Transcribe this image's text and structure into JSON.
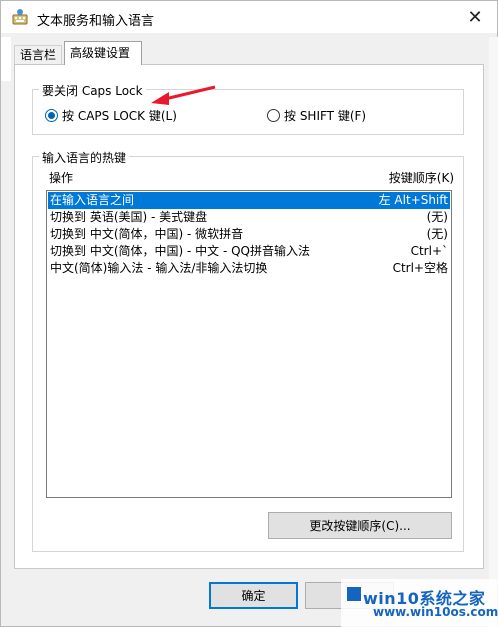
{
  "window": {
    "title": "文本服务和输入语言",
    "close_glyph": "✕"
  },
  "tabs": [
    {
      "label": "语言栏"
    },
    {
      "label": "高级键设置"
    }
  ],
  "caps_lock_group": {
    "label": "要关闭 Caps Lock",
    "option_caps": "按 CAPS LOCK 键(L)",
    "option_shift": "按 SHIFT 键(F)",
    "selected": "caps"
  },
  "hotkeys_group": {
    "label": "输入语言的热键",
    "col_operation": "操作",
    "col_sequence": "按键顺序(K)",
    "rows": [
      {
        "operation": "在输入语言之间",
        "keys": "左 Alt+Shift",
        "selected": true
      },
      {
        "operation": "切换到 英语(美国) - 美式键盘",
        "keys": "(无)",
        "selected": false
      },
      {
        "operation": "切换到 中文(简体，中国) - 微软拼音",
        "keys": "(无)",
        "selected": false
      },
      {
        "operation": "切换到 中文(简体，中国) - 中文 - QQ拼音输入法",
        "keys": "Ctrl+`",
        "selected": false
      },
      {
        "operation": "中文(简体)输入法 - 输入法/非输入法切换",
        "keys": "Ctrl+空格",
        "selected": false
      }
    ],
    "change_sequence_button": "更改按键顺序(C)..."
  },
  "footer": {
    "ok_button": "确定"
  },
  "watermark": {
    "line1": "win10系统之家",
    "line2": "www.win10os.com"
  },
  "colors": {
    "accent": "#0078d7",
    "annotation_arrow": "#e8192c"
  }
}
